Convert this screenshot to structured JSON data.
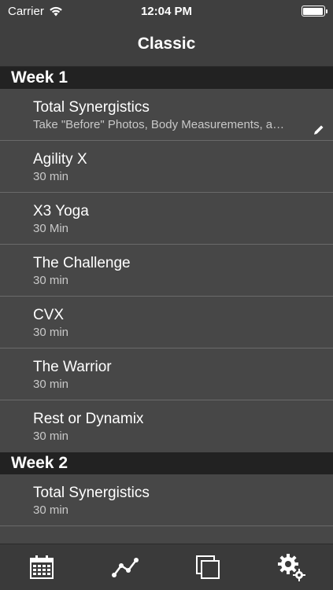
{
  "status_bar": {
    "carrier": "Carrier",
    "time": "12:04 PM"
  },
  "nav": {
    "title": "Classic"
  },
  "sections": [
    {
      "title": "Week 1",
      "rows": [
        {
          "title": "Total Synergistics",
          "subtitle": "Take \"Before\" Photos, Body Measurements, a…"
        },
        {
          "title": "Agility X",
          "subtitle": "30 min"
        },
        {
          "title": "X3 Yoga",
          "subtitle": "30 Min"
        },
        {
          "title": "The Challenge",
          "subtitle": "30 min"
        },
        {
          "title": "CVX",
          "subtitle": "30 min"
        },
        {
          "title": "The Warrior",
          "subtitle": "30 min"
        },
        {
          "title": "Rest or Dynamix",
          "subtitle": "30 min"
        }
      ]
    },
    {
      "title": "Week 2",
      "rows": [
        {
          "title": "Total Synergistics",
          "subtitle": "30 min"
        }
      ]
    }
  ],
  "tab_bar": {
    "tabs": [
      {
        "icon": "calendar-icon"
      },
      {
        "icon": "progress-chart-icon"
      },
      {
        "icon": "photos-icon"
      },
      {
        "icon": "settings-gears-icon"
      }
    ]
  }
}
